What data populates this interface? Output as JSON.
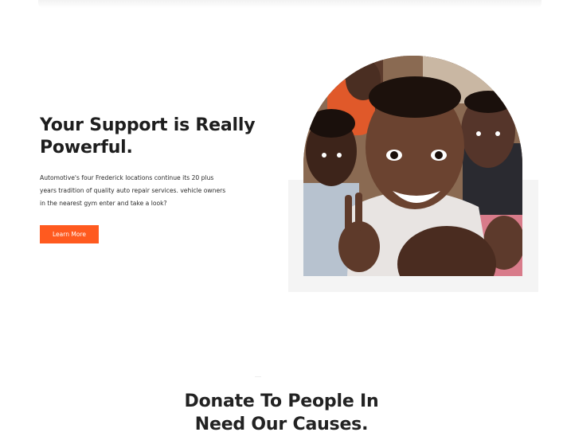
{
  "hero": {
    "title_line1": "Your Support is Really",
    "title_line2": "Powerful.",
    "description": "Automotive's four Frederick locations continue its 20 plus years tradition of quality auto repair services. vehicle owners in the nearest gym enter and take a look?",
    "button_label": "Learn More"
  },
  "causes": {
    "title_line1": "Donate To People In",
    "title_line2": "Need Our Causes."
  },
  "colors": {
    "accent": "#ff5a1f",
    "heading": "#1e1e1e",
    "backdrop": "#f4f4f4"
  }
}
